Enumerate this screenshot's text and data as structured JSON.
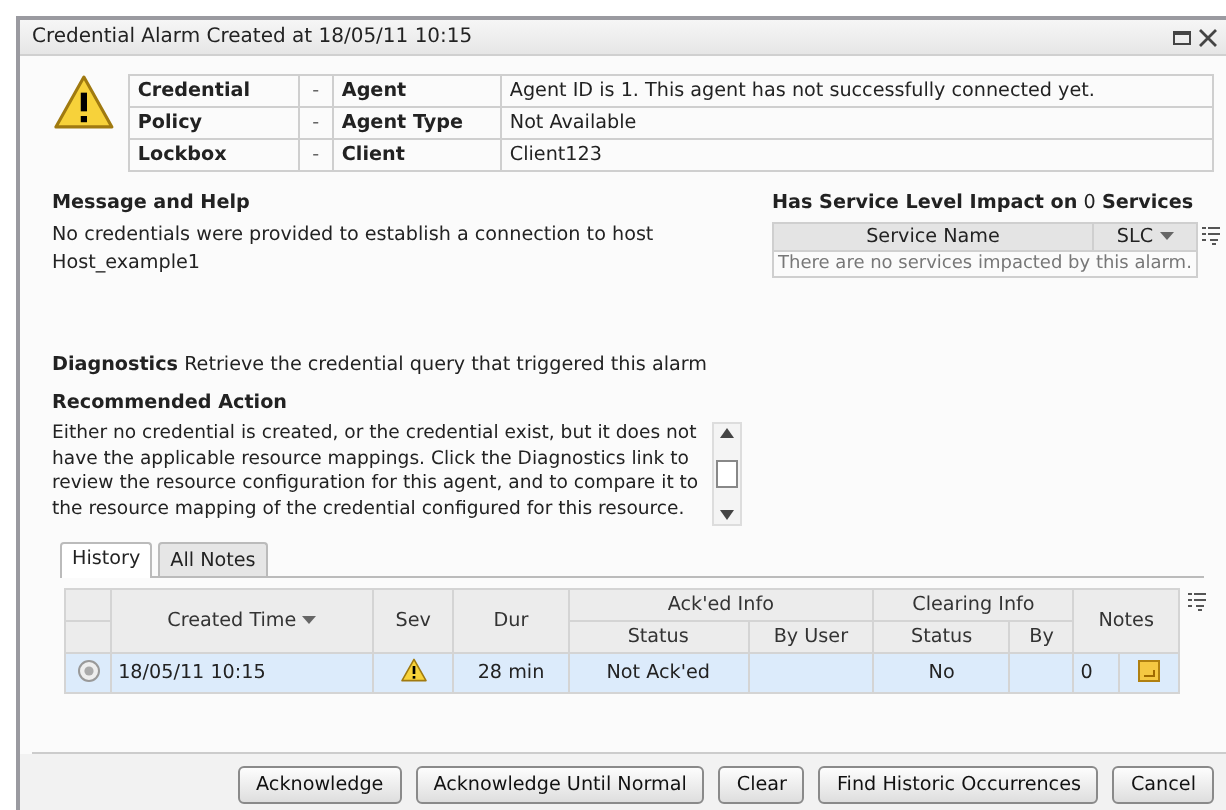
{
  "window": {
    "title": "Credential Alarm Created at 18/05/11 10:15"
  },
  "details": [
    {
      "label": "Credential",
      "label_value": "-",
      "field": "Agent",
      "value": "Agent ID is 1. This agent has not successfully connected yet."
    },
    {
      "label": "Policy",
      "label_value": "-",
      "field": "Agent Type",
      "value": "Not Available"
    },
    {
      "label": "Lockbox",
      "label_value": "-",
      "field": "Client",
      "value": "Client123"
    }
  ],
  "message_and_help": {
    "heading": "Message and Help",
    "text": "No credentials were provided to establish a connection to host\nHost_example1"
  },
  "service_impact": {
    "heading": "**Has Service Level Impact on** 0 **Services**",
    "columns": [
      "Service Name",
      "SLC"
    ],
    "empty_message": "There are no services impacted by this alarm."
  },
  "diagnostics": {
    "label": "Diagnostics",
    "text": "Retrieve the credential query that triggered this alarm"
  },
  "recommended_action": {
    "heading": "Recommended Action",
    "text": "Either no credential is created, or the credential exist, but it does not have the applicable resource mappings. Click the Diagnostics link to review the resource configuration for this agent, and to compare it to the resource mapping of the credential configured for this resource."
  },
  "tabs": [
    {
      "label": "History",
      "selected": true
    },
    {
      "label": "All Notes",
      "selected": false
    }
  ],
  "history": {
    "columns": {
      "created_time": "Created Time",
      "sev": "Sev",
      "dur": "Dur",
      "acked_info": "Ack'ed Info",
      "acked_status": "Status",
      "acked_by": "By User",
      "clearing_info": "Clearing Info",
      "clearing_status": "Status",
      "clearing_by": "By",
      "notes": "Notes"
    },
    "rows": [
      {
        "selected": true,
        "created_time": "18/05/11 10:15",
        "dur": "28 min",
        "acked_status": "Not Ack'ed",
        "acked_by_user": "",
        "clearing_status": "No",
        "notes_count": "0"
      }
    ]
  },
  "buttons": [
    "Acknowledge",
    "Acknowledge Until Normal",
    "Clear",
    "Find Historic Occurrences",
    "Cancel"
  ]
}
